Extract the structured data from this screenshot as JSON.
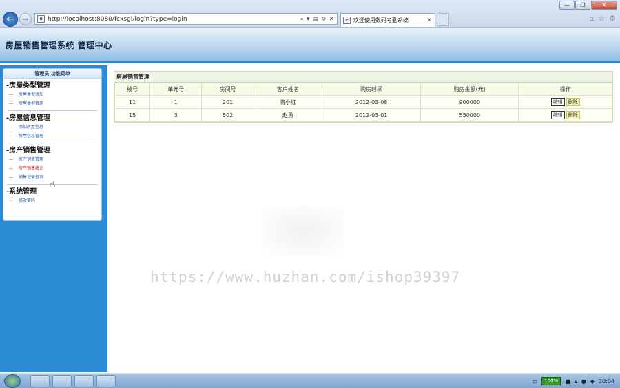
{
  "browser": {
    "url": "http://localhost:8080/fcxsgl/login?type=login",
    "tab_title": "欢迎使用数码考勤系统",
    "window_buttons": [
      "—",
      "❐",
      "✕"
    ]
  },
  "header": {
    "title": "房屋销售管理系统  管理中心"
  },
  "sidebar": {
    "header": "管理员   功能菜单",
    "groups": [
      {
        "title": "房屋类型管理",
        "items": [
          "房屋类型添加",
          "房屋类型管理"
        ]
      },
      {
        "title": "房屋信息管理",
        "items": [
          "添加房屋信息",
          "房屋信息管理"
        ]
      },
      {
        "title": "房产销售管理",
        "items": [
          "房产销售管理",
          "房产销售统计",
          "销售记录查询"
        ]
      },
      {
        "title": "系统管理",
        "items": [
          "修改密码"
        ]
      }
    ]
  },
  "main": {
    "panel_title": "房屋销售管理",
    "columns": [
      "楼号",
      "单元号",
      "房间号",
      "客户姓名",
      "购房时间",
      "购房金额(元)",
      "操作"
    ],
    "rows": [
      [
        "11",
        "1",
        "201",
        "将小红",
        "2012-03-08",
        "900000"
      ],
      [
        "15",
        "3",
        "502",
        "赵勇",
        "2012-03-01",
        "550000"
      ]
    ],
    "edit_label": "编辑",
    "delete_label": "删除"
  },
  "watermark": "https://www.huzhan.com/ishop39397",
  "taskbar": {
    "battery": "100%",
    "clock": "20:04"
  }
}
